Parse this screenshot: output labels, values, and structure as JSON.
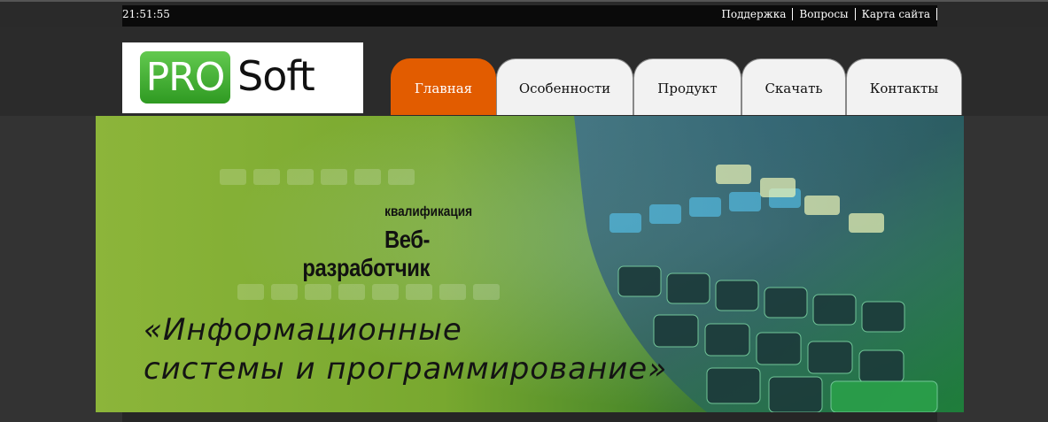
{
  "topbar": {
    "time": "21:51:55",
    "links": [
      "Поддержка",
      "Вопросы",
      "Карта сайта"
    ]
  },
  "logo": {
    "part1": "PRO",
    "part2": "Soft"
  },
  "nav": {
    "tabs": [
      "Главная",
      "Особенности",
      "Продукт",
      "Скачать",
      "Контакты"
    ],
    "active": "Главная"
  },
  "banner": {
    "qualification_label": "квалификация",
    "qualification_value": "Веб-разработчик",
    "program_line1": "«Информационные",
    "program_line2": "системы и программирование»"
  },
  "colors": {
    "accent": "#e25c00",
    "logo_green": "#3aa52b",
    "background": "#333333"
  }
}
